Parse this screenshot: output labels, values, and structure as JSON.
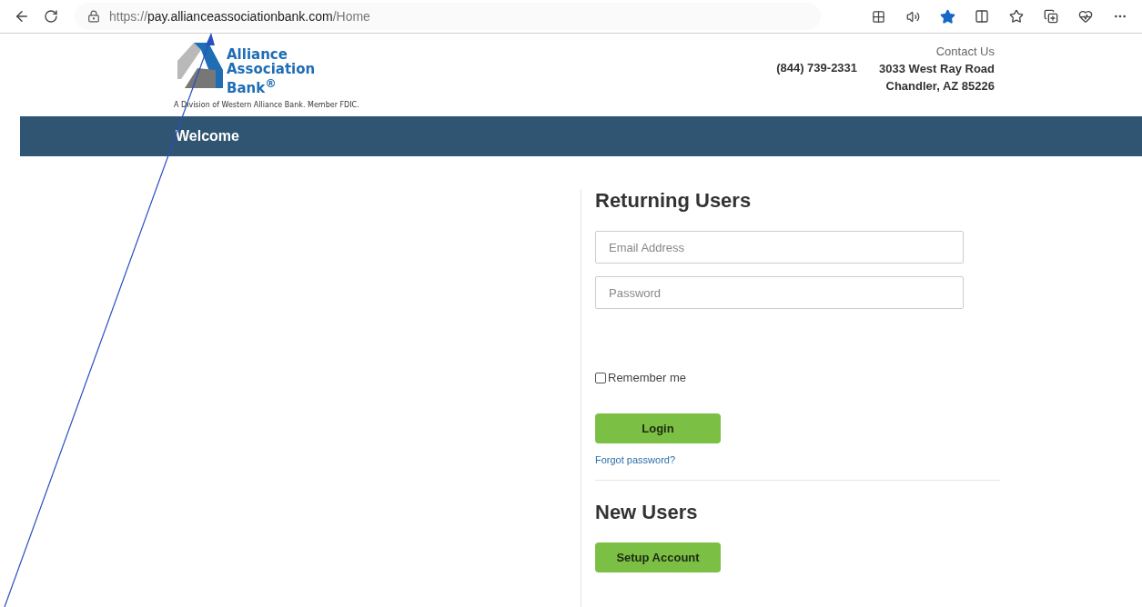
{
  "browser": {
    "url": {
      "scheme": "https://",
      "host": "pay.allianceassociationbank.com",
      "path": "/Home"
    },
    "toolbar_icons": [
      {
        "kind": "apps"
      },
      {
        "kind": "read-aloud"
      },
      {
        "kind": "favorite",
        "selected": true
      },
      {
        "kind": "split"
      },
      {
        "kind": "favorites"
      },
      {
        "kind": "collections"
      },
      {
        "kind": "health"
      },
      {
        "kind": "more"
      }
    ]
  },
  "header": {
    "logo": {
      "lines": [
        "Alliance",
        "Association",
        "Bank$^{®}$"
      ],
      "tagline": "A Division of Western Alliance Bank. Member FDIC."
    },
    "contact_label": "Contact Us",
    "phone": "(844) 739-2331",
    "address": [
      "3033 West Ray Road",
      "Chandler, AZ 85226"
    ]
  },
  "nav": {
    "title": "Welcome"
  },
  "returning": {
    "title": "Returning Users",
    "fields": [
      {
        "placeholder": "Email Address"
      },
      {
        "placeholder": "Password"
      }
    ],
    "remember": {
      "label": "Remember me",
      "checked": false
    },
    "login": "Login",
    "forgot": "Forgot password?"
  },
  "new_users": {
    "title": "New Users",
    "button": "Setup Account"
  }
}
